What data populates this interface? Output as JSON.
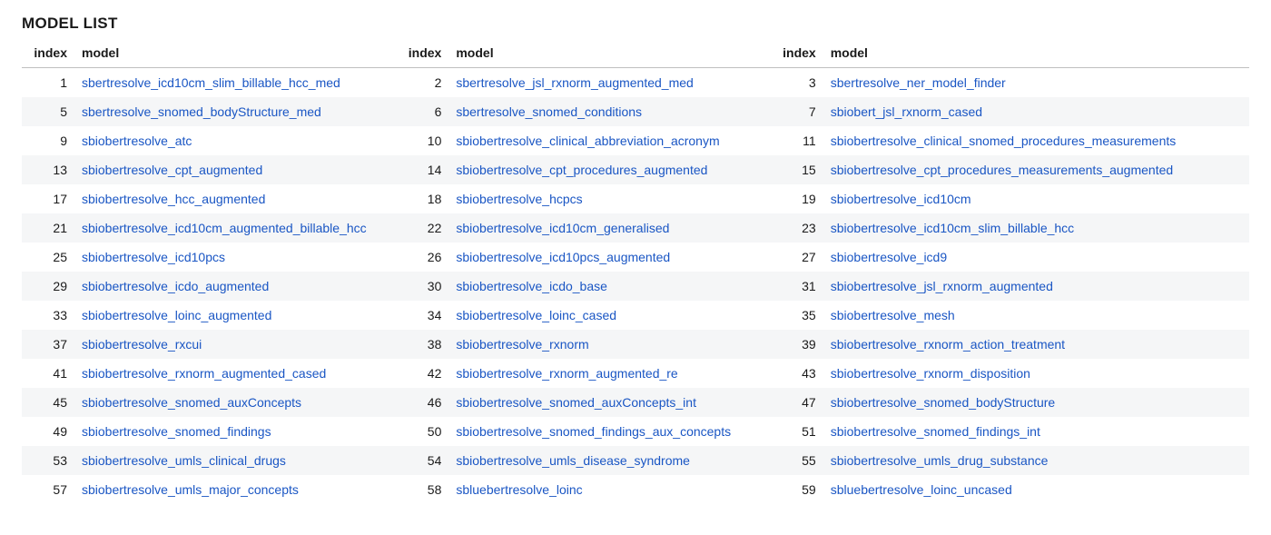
{
  "title": "MODEL LIST",
  "columns": {
    "index": "index",
    "model": "model"
  },
  "col_widths_pct": [
    30.5,
    30.5,
    39
  ],
  "rows": [
    {
      "cells": [
        {
          "index": 1,
          "model": "sbertresolve_icd10cm_slim_billable_hcc_med"
        },
        {
          "index": 2,
          "model": "sbertresolve_jsl_rxnorm_augmented_med"
        },
        {
          "index": 3,
          "model": "sbertresolve_ner_model_finder"
        }
      ]
    },
    {
      "cells": [
        {
          "index": 5,
          "model": "sbertresolve_snomed_bodyStructure_med"
        },
        {
          "index": 6,
          "model": "sbertresolve_snomed_conditions"
        },
        {
          "index": 7,
          "model": "sbiobert_jsl_rxnorm_cased"
        }
      ]
    },
    {
      "cells": [
        {
          "index": 9,
          "model": "sbiobertresolve_atc"
        },
        {
          "index": 10,
          "model": "sbiobertresolve_clinical_abbreviation_acronym"
        },
        {
          "index": 11,
          "model": "sbiobertresolve_clinical_snomed_procedures_measurements"
        }
      ]
    },
    {
      "cells": [
        {
          "index": 13,
          "model": "sbiobertresolve_cpt_augmented"
        },
        {
          "index": 14,
          "model": "sbiobertresolve_cpt_procedures_augmented"
        },
        {
          "index": 15,
          "model": "sbiobertresolve_cpt_procedures_measurements_augmented"
        }
      ]
    },
    {
      "cells": [
        {
          "index": 17,
          "model": "sbiobertresolve_hcc_augmented"
        },
        {
          "index": 18,
          "model": "sbiobertresolve_hcpcs"
        },
        {
          "index": 19,
          "model": "sbiobertresolve_icd10cm"
        }
      ]
    },
    {
      "cells": [
        {
          "index": 21,
          "model": "sbiobertresolve_icd10cm_augmented_billable_hcc"
        },
        {
          "index": 22,
          "model": "sbiobertresolve_icd10cm_generalised"
        },
        {
          "index": 23,
          "model": "sbiobertresolve_icd10cm_slim_billable_hcc"
        }
      ]
    },
    {
      "cells": [
        {
          "index": 25,
          "model": "sbiobertresolve_icd10pcs"
        },
        {
          "index": 26,
          "model": "sbiobertresolve_icd10pcs_augmented"
        },
        {
          "index": 27,
          "model": "sbiobertresolve_icd9"
        }
      ]
    },
    {
      "cells": [
        {
          "index": 29,
          "model": "sbiobertresolve_icdo_augmented"
        },
        {
          "index": 30,
          "model": "sbiobertresolve_icdo_base"
        },
        {
          "index": 31,
          "model": "sbiobertresolve_jsl_rxnorm_augmented"
        }
      ]
    },
    {
      "cells": [
        {
          "index": 33,
          "model": "sbiobertresolve_loinc_augmented"
        },
        {
          "index": 34,
          "model": "sbiobertresolve_loinc_cased"
        },
        {
          "index": 35,
          "model": "sbiobertresolve_mesh"
        }
      ]
    },
    {
      "cells": [
        {
          "index": 37,
          "model": "sbiobertresolve_rxcui"
        },
        {
          "index": 38,
          "model": "sbiobertresolve_rxnorm"
        },
        {
          "index": 39,
          "model": "sbiobertresolve_rxnorm_action_treatment"
        }
      ]
    },
    {
      "cells": [
        {
          "index": 41,
          "model": "sbiobertresolve_rxnorm_augmented_cased"
        },
        {
          "index": 42,
          "model": "sbiobertresolve_rxnorm_augmented_re"
        },
        {
          "index": 43,
          "model": "sbiobertresolve_rxnorm_disposition"
        }
      ]
    },
    {
      "cells": [
        {
          "index": 45,
          "model": "sbiobertresolve_snomed_auxConcepts"
        },
        {
          "index": 46,
          "model": "sbiobertresolve_snomed_auxConcepts_int"
        },
        {
          "index": 47,
          "model": "sbiobertresolve_snomed_bodyStructure"
        }
      ]
    },
    {
      "cells": [
        {
          "index": 49,
          "model": "sbiobertresolve_snomed_findings"
        },
        {
          "index": 50,
          "model": "sbiobertresolve_snomed_findings_aux_concepts"
        },
        {
          "index": 51,
          "model": "sbiobertresolve_snomed_findings_int"
        }
      ]
    },
    {
      "cells": [
        {
          "index": 53,
          "model": "sbiobertresolve_umls_clinical_drugs"
        },
        {
          "index": 54,
          "model": "sbiobertresolve_umls_disease_syndrome"
        },
        {
          "index": 55,
          "model": "sbiobertresolve_umls_drug_substance"
        }
      ]
    },
    {
      "cells": [
        {
          "index": 57,
          "model": "sbiobertresolve_umls_major_concepts"
        },
        {
          "index": 58,
          "model": "sbluebertresolve_loinc"
        },
        {
          "index": 59,
          "model": "sbluebertresolve_loinc_uncased"
        }
      ]
    }
  ]
}
